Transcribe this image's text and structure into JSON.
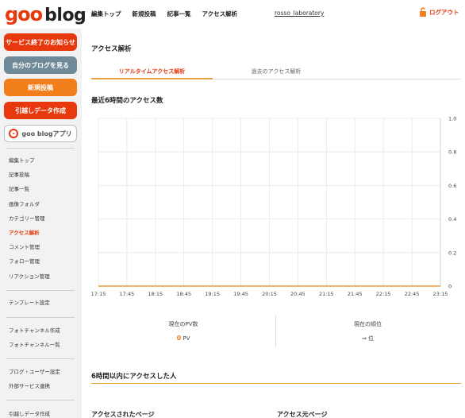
{
  "header": {
    "logo_goo": "goo",
    "logo_blog": "blog",
    "nav": [
      "編集トップ",
      "新規投稿",
      "記事一覧",
      "アクセス解析"
    ],
    "username": "rosso_laboratory",
    "logout": "ログアウト"
  },
  "sidebar": {
    "buttons": {
      "service_end": "サービス終了のお知らせ",
      "view_blog": "自分のブログを見る",
      "new_post": "新規投稿",
      "data_transfer": "引越しデータ作成",
      "goo_app": "goo blogアプリ"
    },
    "menu1": [
      "編集トップ",
      "記事投稿",
      "記事一覧",
      "画像フォルダ",
      "カテゴリー管理",
      "アクセス解析",
      "コメント管理",
      "フォロー管理",
      "リアクション管理"
    ],
    "menu2": [
      "テンプレート設定"
    ],
    "menu3": [
      "フォトチャンネル作成",
      "フォトチャンネル一覧"
    ],
    "menu4": [
      "ブログ・ユーザー設定",
      "外部サービス連携"
    ],
    "menu5": [
      "引越しデータ作成"
    ]
  },
  "main": {
    "page_title": "アクセス解析",
    "tabs": [
      "リアルタイムアクセス解析",
      "過去のアクセス解析"
    ],
    "chart_title": "最近6時間のアクセス数",
    "current_pv_label": "現在のPV数",
    "current_pv_value": "0",
    "current_pv_unit": "PV",
    "current_rank_label": "現在の順位",
    "current_rank_value": "⇒ 位",
    "section_visitors": "6時間以内にアクセスした人",
    "col_pages": "アクセスされたページ",
    "col_sources": "アクセス元ページ"
  },
  "colors": {
    "brand": "#e8380d",
    "accent_orange": "#f27e1c",
    "gray_button": "#6f8a98",
    "tab_underline": "#e8a13c"
  },
  "chart_data": {
    "type": "line",
    "x": [
      "17:15",
      "17:45",
      "18:15",
      "18:45",
      "19:15",
      "19:45",
      "20:15",
      "20:45",
      "21:15",
      "21:45",
      "22:15",
      "22:45",
      "23:15"
    ],
    "series": [
      {
        "values": [
          0,
          0,
          0,
          0,
          0,
          0,
          0,
          0,
          0,
          0,
          0,
          0,
          0
        ]
      }
    ],
    "y_ticks": [
      "0",
      "0.2",
      "0.4",
      "0.6",
      "0.8",
      "1.0"
    ],
    "ylim": [
      0,
      1
    ],
    "grid": true,
    "y_axis_side": "right",
    "line_color": "#e8a13c"
  }
}
